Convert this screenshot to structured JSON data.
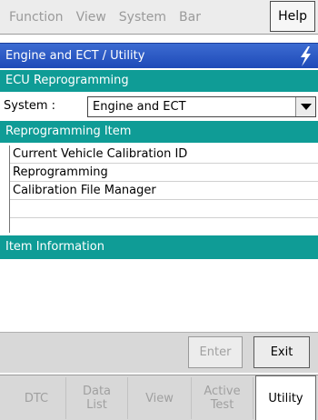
{
  "menubar": {
    "items": [
      "Function",
      "View",
      "System",
      "Bar",
      "Help"
    ]
  },
  "title": "Engine and ECT / Utility",
  "ecu_section": {
    "header": "ECU Reprogramming",
    "system_label": "System :",
    "system_value": "Engine and ECT"
  },
  "repro_section": {
    "header": "Reprogramming Item",
    "items": [
      "Current Vehicle Calibration ID",
      "Reprogramming",
      "Calibration File Manager"
    ]
  },
  "info_section": {
    "header": "Item Information"
  },
  "buttons": {
    "enter": "Enter",
    "exit": "Exit"
  },
  "tabs": {
    "dtc": "DTC",
    "data_list_1": "Data",
    "data_list_2": "List",
    "view": "View",
    "active_test_1": "Active",
    "active_test_2": "Test",
    "utility": "Utility"
  },
  "colors": {
    "title_bar": "#2a56c4",
    "section_header": "#0f9c96",
    "bolt_icon": "#ffffff"
  }
}
